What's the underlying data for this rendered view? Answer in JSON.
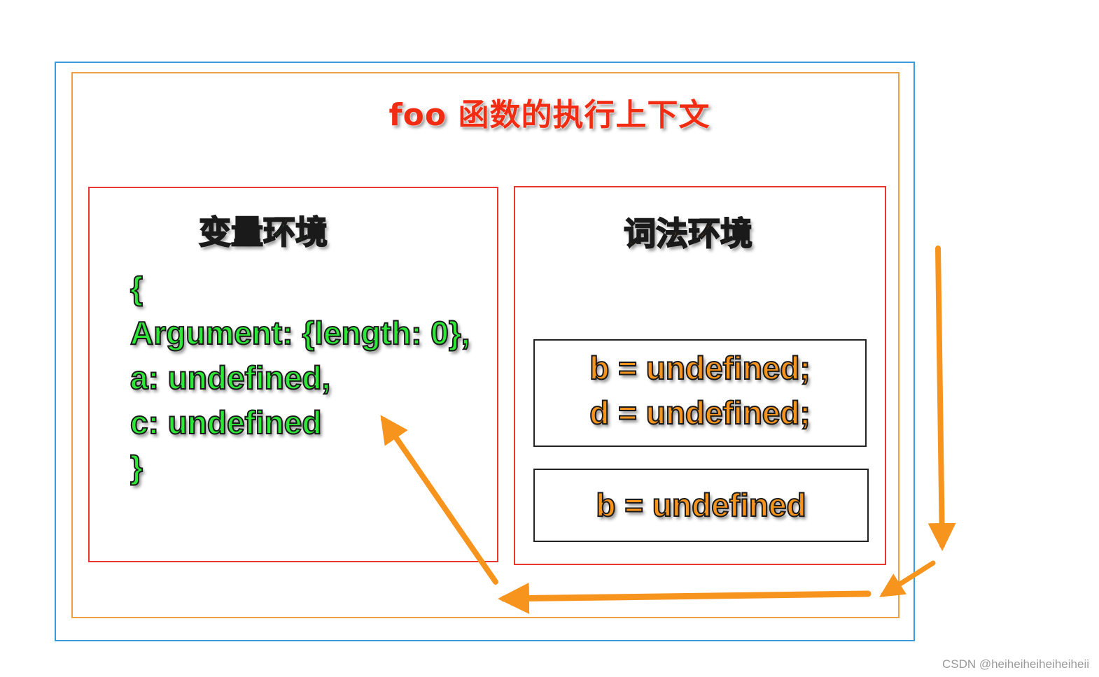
{
  "title": "foo 函数的执行上下文",
  "variable_environment": {
    "heading": "变量环境",
    "lines": [
      "{",
      "Argument: {length: 0},",
      "a: undefined,",
      "c: undefined",
      "}"
    ]
  },
  "lexical_environment": {
    "heading": "词法环境",
    "blocks": [
      {
        "lines": [
          "b = undefined;",
          "d = undefined;"
        ]
      },
      {
        "lines": [
          "b = undefined"
        ]
      }
    ]
  },
  "watermark": "CSDN @heiheiheiheiheiheii",
  "colors": {
    "title": "#f22c12",
    "green_text": "#2ee838",
    "orange_text": "#f7941e",
    "arrow": "#f7941e",
    "outer_border": "#3a9bdc",
    "context_border": "#f0a040",
    "env_border": "#e8372c"
  }
}
